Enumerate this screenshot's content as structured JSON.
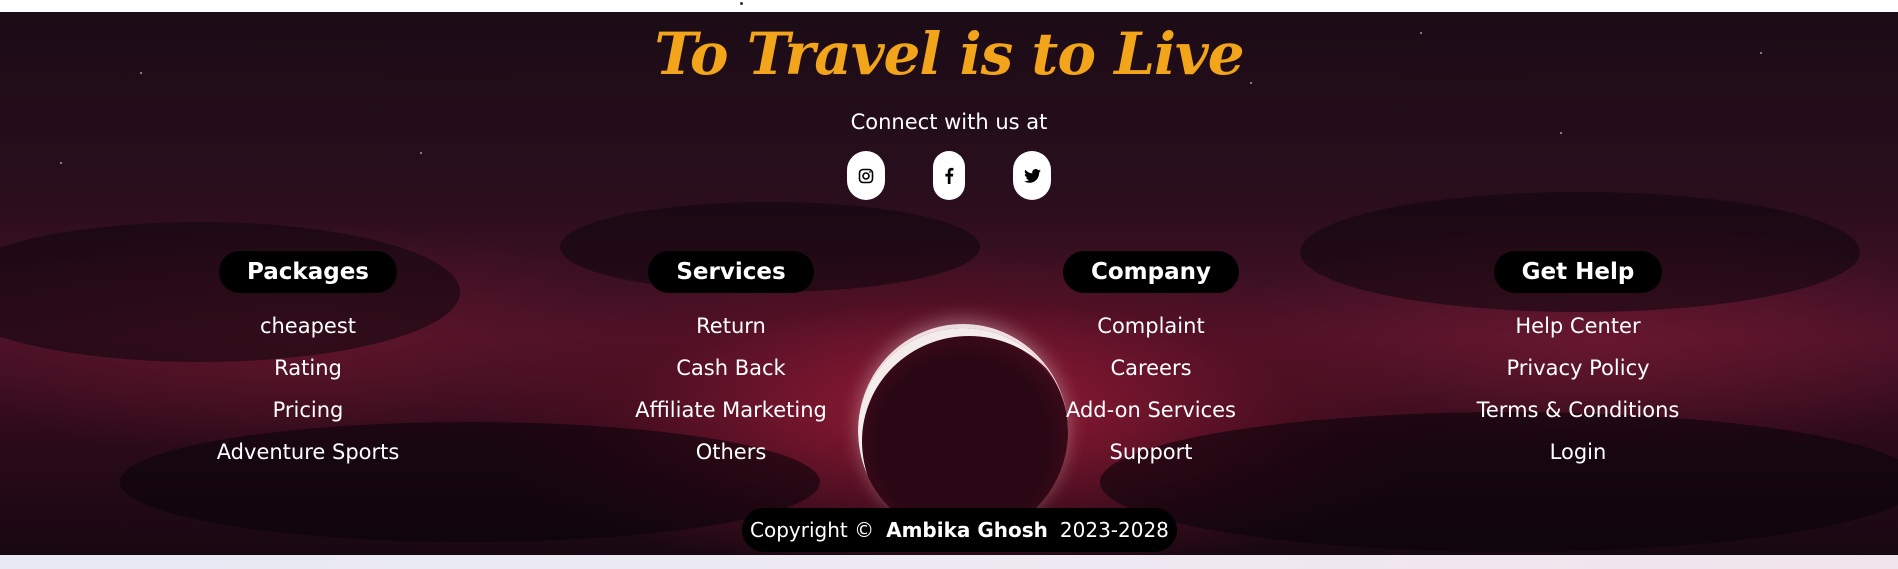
{
  "footer": {
    "tagline": "To Travel is to Live",
    "connect_text": "Connect with us at",
    "social": [
      {
        "icon": "instagram-icon"
      },
      {
        "icon": "facebook-icon"
      },
      {
        "icon": "twitter-icon"
      }
    ],
    "columns": [
      {
        "title": "Packages",
        "links": [
          "cheapest",
          "Rating",
          "Pricing",
          "Adventure Sports"
        ]
      },
      {
        "title": "Services",
        "links": [
          "Return",
          "Cash Back",
          "Affiliate Marketing",
          "Others"
        ]
      },
      {
        "title": "Company",
        "links": [
          "Complaint",
          "Careers",
          "Add-on Services",
          "Support"
        ]
      },
      {
        "title": "Get Help",
        "links": [
          "Help Center",
          "Privacy Policy",
          "Terms & Conditions",
          "Login"
        ]
      }
    ],
    "copyright": {
      "prefix": "Copyright ©",
      "author": "Ambika Ghosh",
      "years": "2023-2028"
    },
    "colors": {
      "tagline": "#f2a41a",
      "pill_bg": "#000000",
      "text": "#ffffff"
    }
  }
}
